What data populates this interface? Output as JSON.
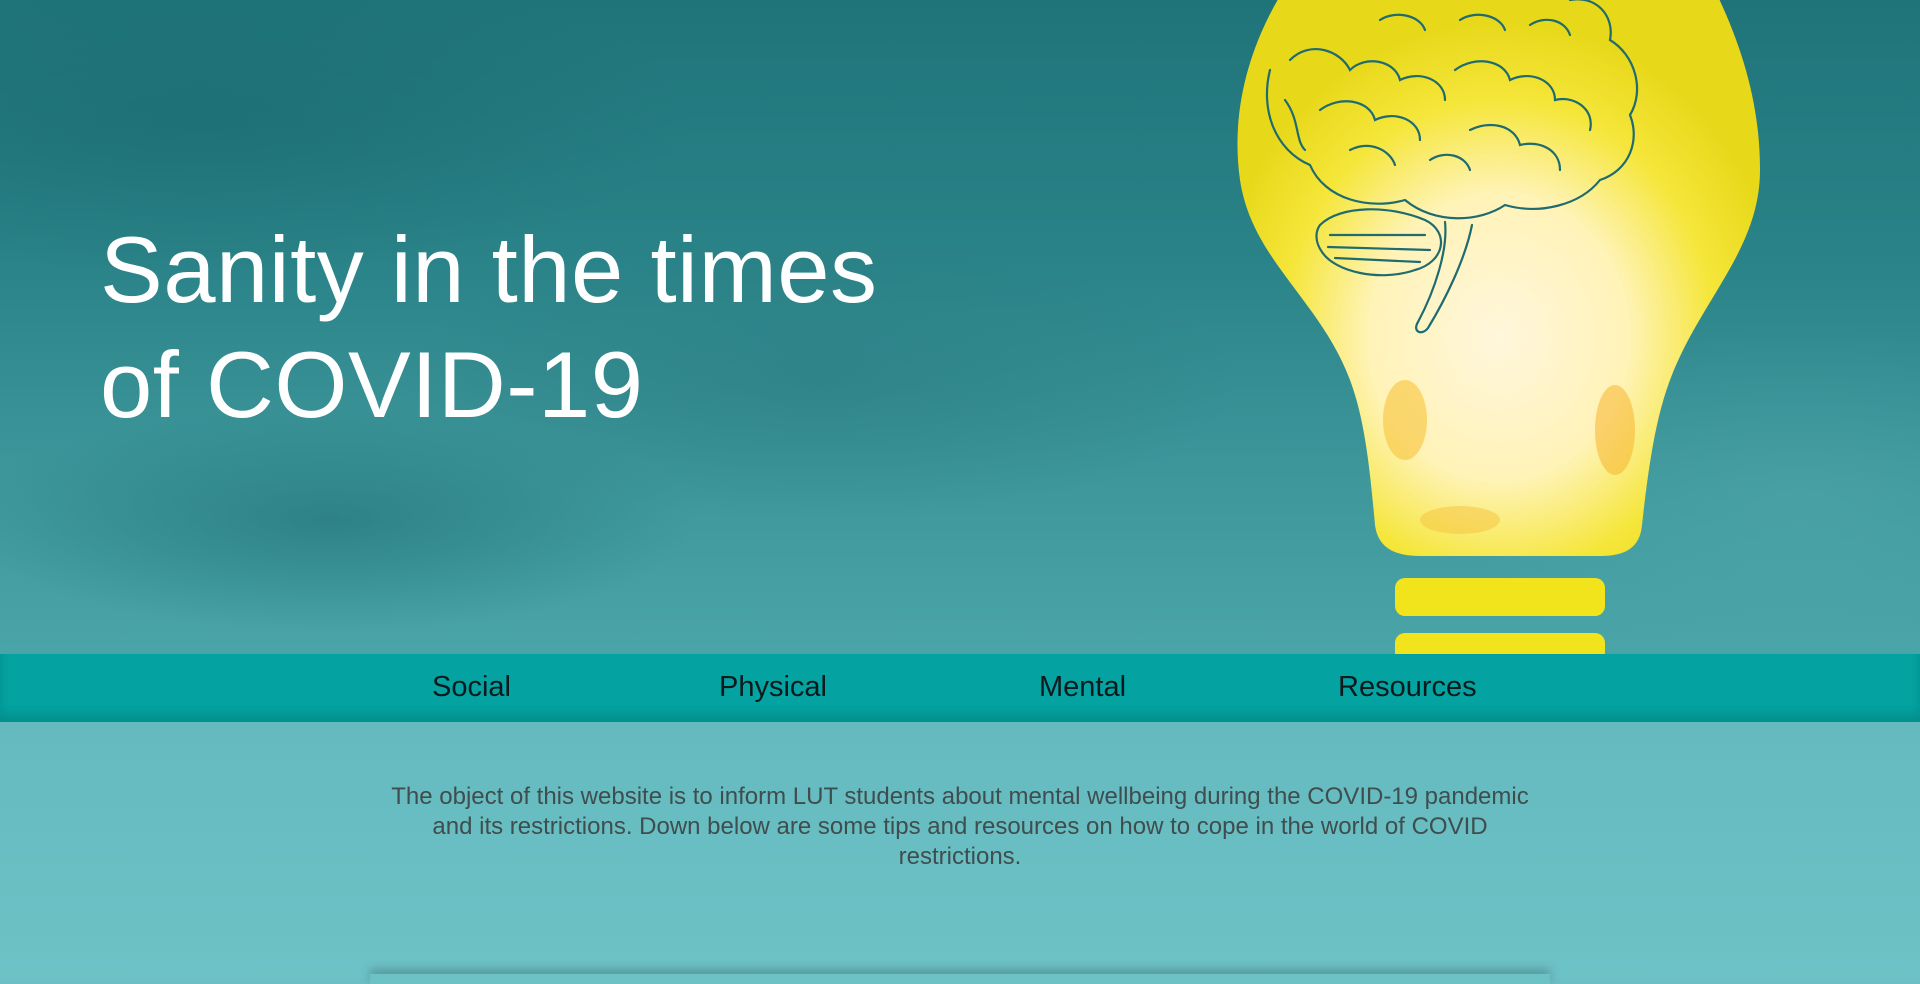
{
  "hero": {
    "title": "Sanity in the times of COVID-19",
    "illustration": "lightbulb-brain-illustration"
  },
  "nav": {
    "items": [
      {
        "label": "Social"
      },
      {
        "label": "Physical"
      },
      {
        "label": "Mental"
      },
      {
        "label": "Resources"
      }
    ]
  },
  "intro": {
    "text": "The object of this website is to inform LUT students about mental wellbeing during the COVID-19 pandemic and its restrictions. Down below are some tips and resources on how to cope in the world of COVID restrictions."
  },
  "colors": {
    "hero_bg": "#2a8388",
    "nav_bg": "#04a2a1",
    "content_bg": "#6cbfc4",
    "bulb_yellow": "#f2e41c",
    "brain_line": "#1e6b70"
  }
}
